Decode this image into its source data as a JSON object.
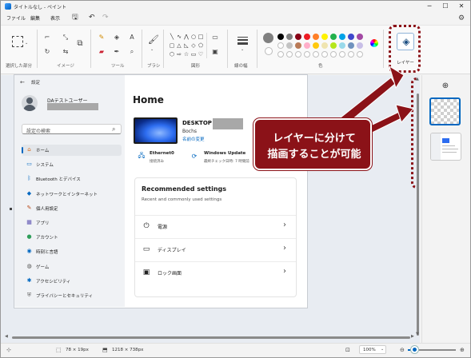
{
  "window": {
    "title": "タイトルなし - ペイント"
  },
  "menu": {
    "items": [
      "ファイル",
      "編集",
      "表示"
    ]
  },
  "ribbon": {
    "groups": [
      "選択した部分",
      "イメージ",
      "ツール",
      "ブラシ",
      "図形",
      "線の幅",
      "色"
    ],
    "layers_label": "レイヤー"
  },
  "settings": {
    "title": "設定",
    "user_name": "DAテストユーザー",
    "search_placeholder": "設定の検索",
    "nav": [
      {
        "label": "ホーム",
        "icon": "home-icon"
      },
      {
        "label": "システム",
        "icon": "monitor-icon"
      },
      {
        "label": "Bluetooth とデバイス",
        "icon": "bluetooth-icon"
      },
      {
        "label": "ネットワークとインターネット",
        "icon": "wifi-icon"
      },
      {
        "label": "個人用設定",
        "icon": "brush-icon"
      },
      {
        "label": "アプリ",
        "icon": "apps-icon"
      },
      {
        "label": "アカウント",
        "icon": "account-icon"
      },
      {
        "label": "時刻と言語",
        "icon": "globe-icon"
      },
      {
        "label": "ゲーム",
        "icon": "gamepad-icon"
      },
      {
        "label": "アクセシビリティ",
        "icon": "accessibility-icon"
      },
      {
        "label": "プライバシーとセキュリティ",
        "icon": "shield-icon"
      }
    ],
    "home": {
      "title": "Home",
      "pc_name": "DESKTOP",
      "pc_model": "Bochs",
      "rename": "名前の変更",
      "ethernet": {
        "title": "Ethernet0",
        "sub": "接続済み"
      },
      "update": {
        "title": "Windows Update",
        "sub": "最終チェック日時: 7 時間前"
      },
      "recommended_title": "Recommended settings",
      "recommended_sub": "Recent and commonly used settings",
      "rows": [
        {
          "label": "電源",
          "icon": "power-icon"
        },
        {
          "label": "ディスプレイ",
          "icon": "display-icon"
        },
        {
          "label": "ロック画面",
          "icon": "lock-screen-icon"
        }
      ]
    }
  },
  "callout": {
    "lines": [
      "レイヤーに分けて",
      "描画することが可能"
    ]
  },
  "status": {
    "cursor_size": "78 × 19px",
    "canvas_size": "1218 × 738px",
    "zoom": "100%"
  },
  "colors": {
    "accent": "#0067c0",
    "callout": "#8b1218",
    "palette": [
      "#000000",
      "#7f7f7f",
      "#880015",
      "#ed1c24",
      "#ff7f27",
      "#fff200",
      "#22b14c",
      "#00a2e8",
      "#3f48cc",
      "#a349a4",
      "#ffffff",
      "#c3c3c3",
      "#b97a57",
      "#ffaec9",
      "#ffc90e",
      "#efe4b0",
      "#b5e61d",
      "#99d9ea",
      "#7092be",
      "#c8bfe7"
    ]
  }
}
